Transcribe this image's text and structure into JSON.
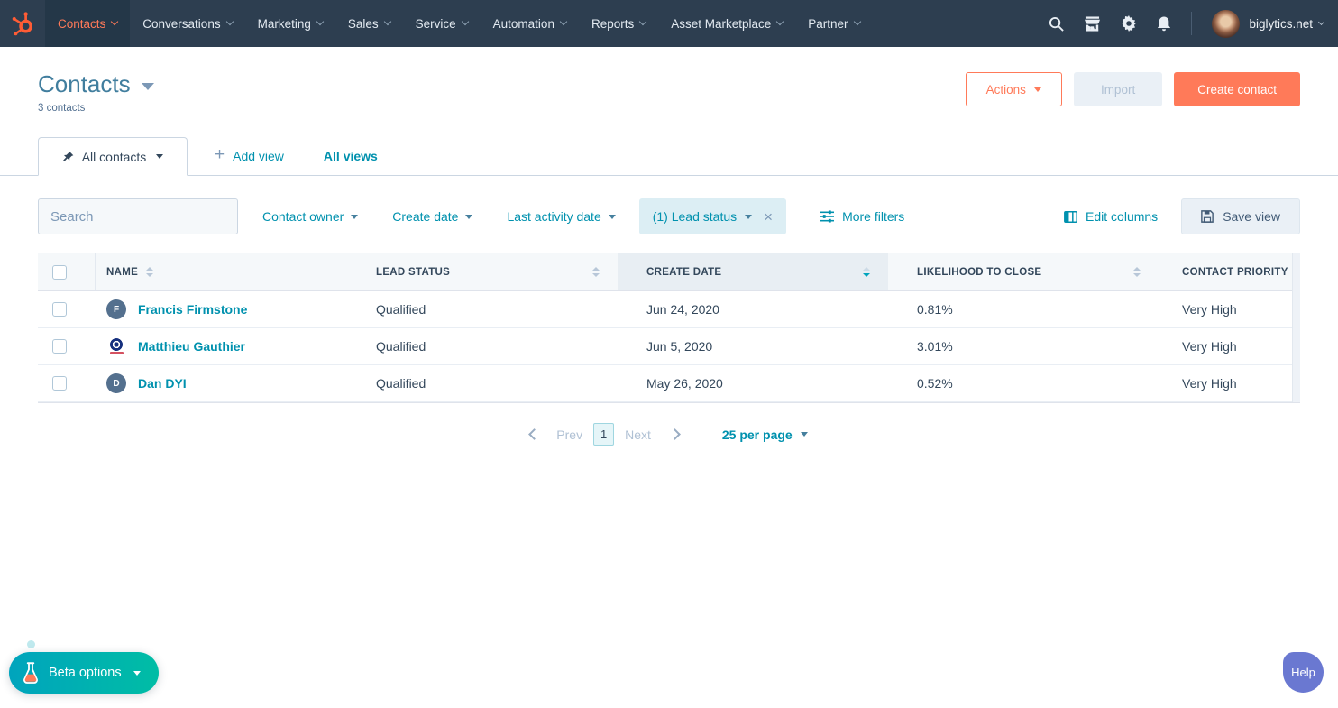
{
  "nav": {
    "items": [
      {
        "label": "Contacts",
        "active": true
      },
      {
        "label": "Conversations"
      },
      {
        "label": "Marketing"
      },
      {
        "label": "Sales"
      },
      {
        "label": "Service"
      },
      {
        "label": "Automation"
      },
      {
        "label": "Reports"
      },
      {
        "label": "Asset Marketplace"
      },
      {
        "label": "Partner"
      }
    ],
    "account": "biglytics.net"
  },
  "icons": {
    "logo": "hubspot-sprocket",
    "nav_right": [
      "search-icon",
      "marketplace-icon",
      "settings-icon",
      "notifications-icon"
    ],
    "tab": "pushpin-icon",
    "more_filters": "sliders-icon",
    "edit_columns": "table-columns-icon",
    "save_view": "floppy-disk-icon",
    "beta": "flask-icon"
  },
  "header": {
    "title": "Contacts",
    "subtitle": "3 contacts",
    "actions": "Actions",
    "import": "Import",
    "create_contact": "Create contact"
  },
  "views": {
    "active_tab": "All contacts",
    "add_view": "Add view",
    "all_views": "All views"
  },
  "filters": {
    "search_placeholder": "Search",
    "contact_owner": "Contact owner",
    "create_date": "Create date",
    "last_activity_date": "Last activity date",
    "lead_status": "(1) Lead status",
    "more_filters": "More filters",
    "edit_columns": "Edit columns",
    "save_view": "Save view"
  },
  "table": {
    "columns": [
      "NAME",
      "LEAD STATUS",
      "CREATE DATE",
      "LIKELIHOOD TO CLOSE",
      "CONTACT PRIORITY"
    ],
    "sorted_column": "CREATE DATE",
    "sort_direction": "descending",
    "rows": [
      {
        "avatar_initial": "F",
        "name": "Francis Firmstone",
        "lead_status": "Qualified",
        "create_date": "Jun 24, 2020",
        "likelihood_to_close": "0.81%",
        "contact_priority": "Very High"
      },
      {
        "avatar_type": "company-logo",
        "name": "Matthieu Gauthier",
        "lead_status": "Qualified",
        "create_date": "Jun 5, 2020",
        "likelihood_to_close": "3.01%",
        "contact_priority": "Very High"
      },
      {
        "avatar_initial": "D",
        "name": "Dan DYI",
        "lead_status": "Qualified",
        "create_date": "May 26, 2020",
        "likelihood_to_close": "0.52%",
        "contact_priority": "Very High"
      }
    ]
  },
  "pagination": {
    "prev": "Prev",
    "current_page": "1",
    "next": "Next",
    "per_page": "25 per page"
  },
  "floating": {
    "beta_options": "Beta options",
    "help": "Help"
  },
  "colors": {
    "nav_bg": "#2d3e50",
    "accent_orange": "#ff7a59",
    "logo_orange": "#ff5c35",
    "link_teal": "#0091ae",
    "title_teal": "#417e9e",
    "help_purple": "#6a78d1",
    "beta_gradient": [
      "#00a4bd",
      "#00bda5"
    ],
    "table_header_bg": "#f5f8fa",
    "sorted_col_bg": "#e8eef3",
    "pill_bg": "#dceef4"
  }
}
